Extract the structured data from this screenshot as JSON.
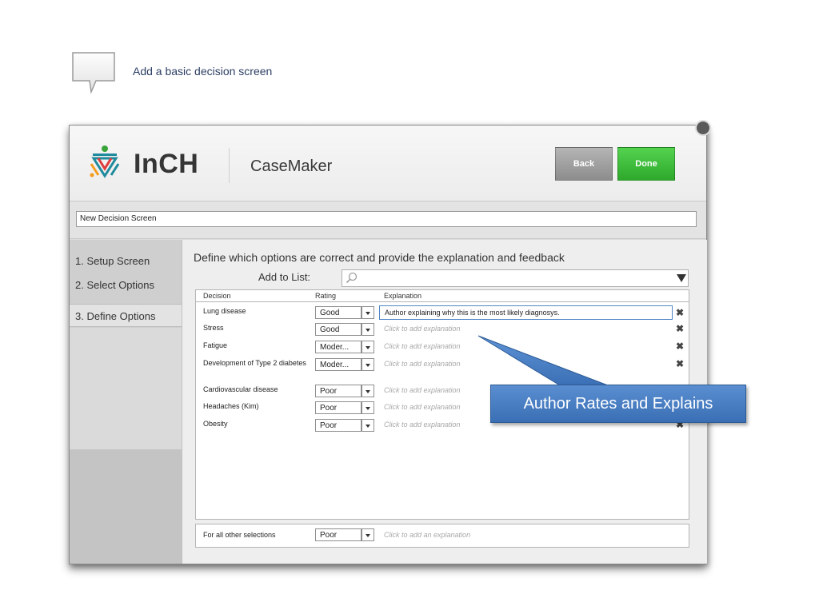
{
  "instruction": {
    "title": "Add a basic decision screen"
  },
  "app": {
    "brand": "InCH",
    "name": "CaseMaker",
    "back_label": "Back",
    "done_label": "Done"
  },
  "screen_name_value": "New Decision Screen",
  "steps": [
    {
      "label": "1. Setup Screen"
    },
    {
      "label": "2. Select Options"
    },
    {
      "label": "3. Define Options"
    }
  ],
  "main": {
    "instruction": "Define which options are correct and provide the explanation and feedback",
    "add_to_list_label": "Add to List:",
    "columns": {
      "decision": "Decision",
      "rating": "Rating",
      "explanation": "Explanation"
    },
    "rows": [
      {
        "decision": "Lung disease",
        "rating": "Good",
        "explanation": "Author explaining why this is the most likely diagnosys."
      },
      {
        "decision": "Stress",
        "rating": "Good",
        "explanation": "Click to add explanation"
      },
      {
        "decision": "Fatigue",
        "rating": "Moder...",
        "explanation": "Click to add explanation"
      },
      {
        "decision": "Development of Type 2 diabetes",
        "rating": "Moder...",
        "explanation": "Click to add explanation"
      },
      {
        "decision": "Cardiovascular disease",
        "rating": "Poor",
        "explanation": "Click to add explanation"
      },
      {
        "decision": "Headaches (Kim)",
        "rating": "Poor",
        "explanation": "Click to add explanation"
      },
      {
        "decision": "Obesity",
        "rating": "Poor",
        "explanation": "Click to add explanation"
      }
    ],
    "other": {
      "decision": "For all other selections",
      "rating": "Poor",
      "explanation": "Click to add an explanation"
    }
  },
  "callout": {
    "text": "Author Rates and Explains"
  },
  "colors": {
    "done": "#3cbb38",
    "back": "#9e9e9e",
    "callout": "#4a7fc4",
    "active_border": "#4f86c6"
  }
}
